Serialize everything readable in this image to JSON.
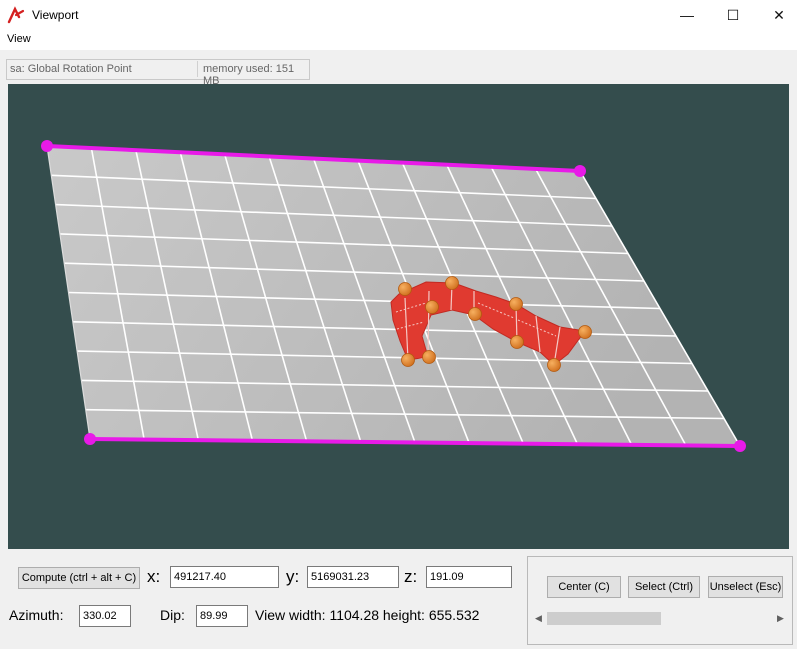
{
  "window": {
    "title": "Viewport"
  },
  "menu": {
    "items": [
      "View"
    ]
  },
  "status": {
    "left": "sa: Global Rotation Point",
    "right": "memory used: 151 MB"
  },
  "controls": {
    "compute_label": "Compute (ctrl + alt + C)",
    "x_label": "x:",
    "x_value": "491217.40",
    "y_label": "y:",
    "y_value": "5169031.23",
    "z_label": "z:",
    "z_value": "191.09",
    "azimuth_label": "Azimuth:",
    "azimuth_value": "330.02",
    "dip_label": "Dip:",
    "dip_value": "89.99",
    "view_info": "View width: 1104.28 height: 655.532"
  },
  "buttons": {
    "center": "Center (C)",
    "select": "Select (Ctrl)",
    "unselect": "Unselect (Esc)"
  },
  "colors": {
    "viewport_bg": "#344d4d",
    "plane": "#bdbdbd",
    "grid_line": "#ffffff",
    "boundary": "#e81ae8",
    "surface": "#e03a30",
    "control_point": "#e8862a"
  },
  "icons": {
    "app": "app-logo-icon",
    "minimize": "minimize-icon",
    "maximize": "maximize-icon",
    "close": "close-icon",
    "scroll_left": "arrow-left-icon",
    "scroll_right": "arrow-right-icon"
  }
}
